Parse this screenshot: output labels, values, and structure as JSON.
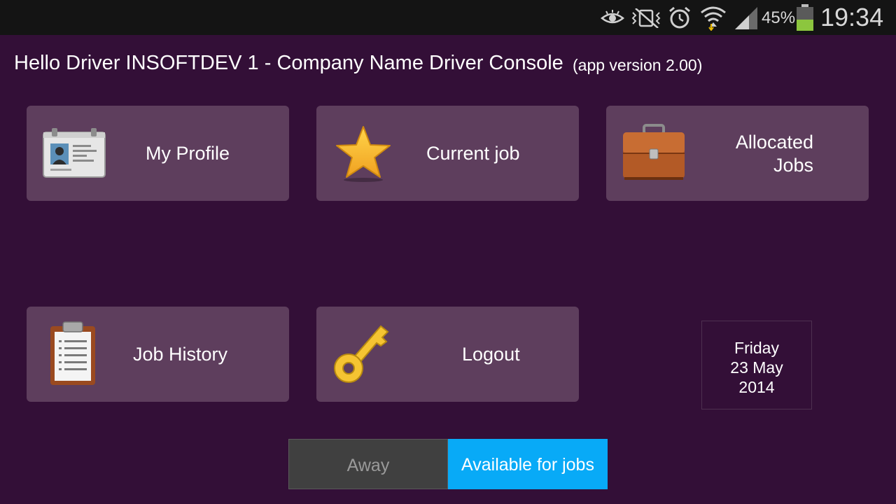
{
  "status_bar": {
    "icons": [
      "eye-icon",
      "mute-icon",
      "alarm-icon",
      "wifi-icon",
      "signal-icon",
      "battery-icon"
    ],
    "battery_percent": "45%",
    "time": "19:34"
  },
  "header": {
    "greeting": "Hello Driver INSOFTDEV 1 - Company Name Driver Console",
    "version": "(app version 2.00)"
  },
  "tiles": [
    {
      "label": "My Profile",
      "icon": "id-card-icon"
    },
    {
      "label": "Current job",
      "icon": "star-icon"
    },
    {
      "label": "Allocated\nJobs",
      "icon": "briefcase-icon"
    },
    {
      "label": "Job History",
      "icon": "clipboard-icon"
    },
    {
      "label": "Logout",
      "icon": "key-icon"
    }
  ],
  "date": {
    "day": "Friday",
    "date": "23 May",
    "year": "2014"
  },
  "availability": {
    "away_label": "Away",
    "available_label": "Available for jobs",
    "selected": "Available for jobs",
    "selected_color": "#08aaf7"
  }
}
